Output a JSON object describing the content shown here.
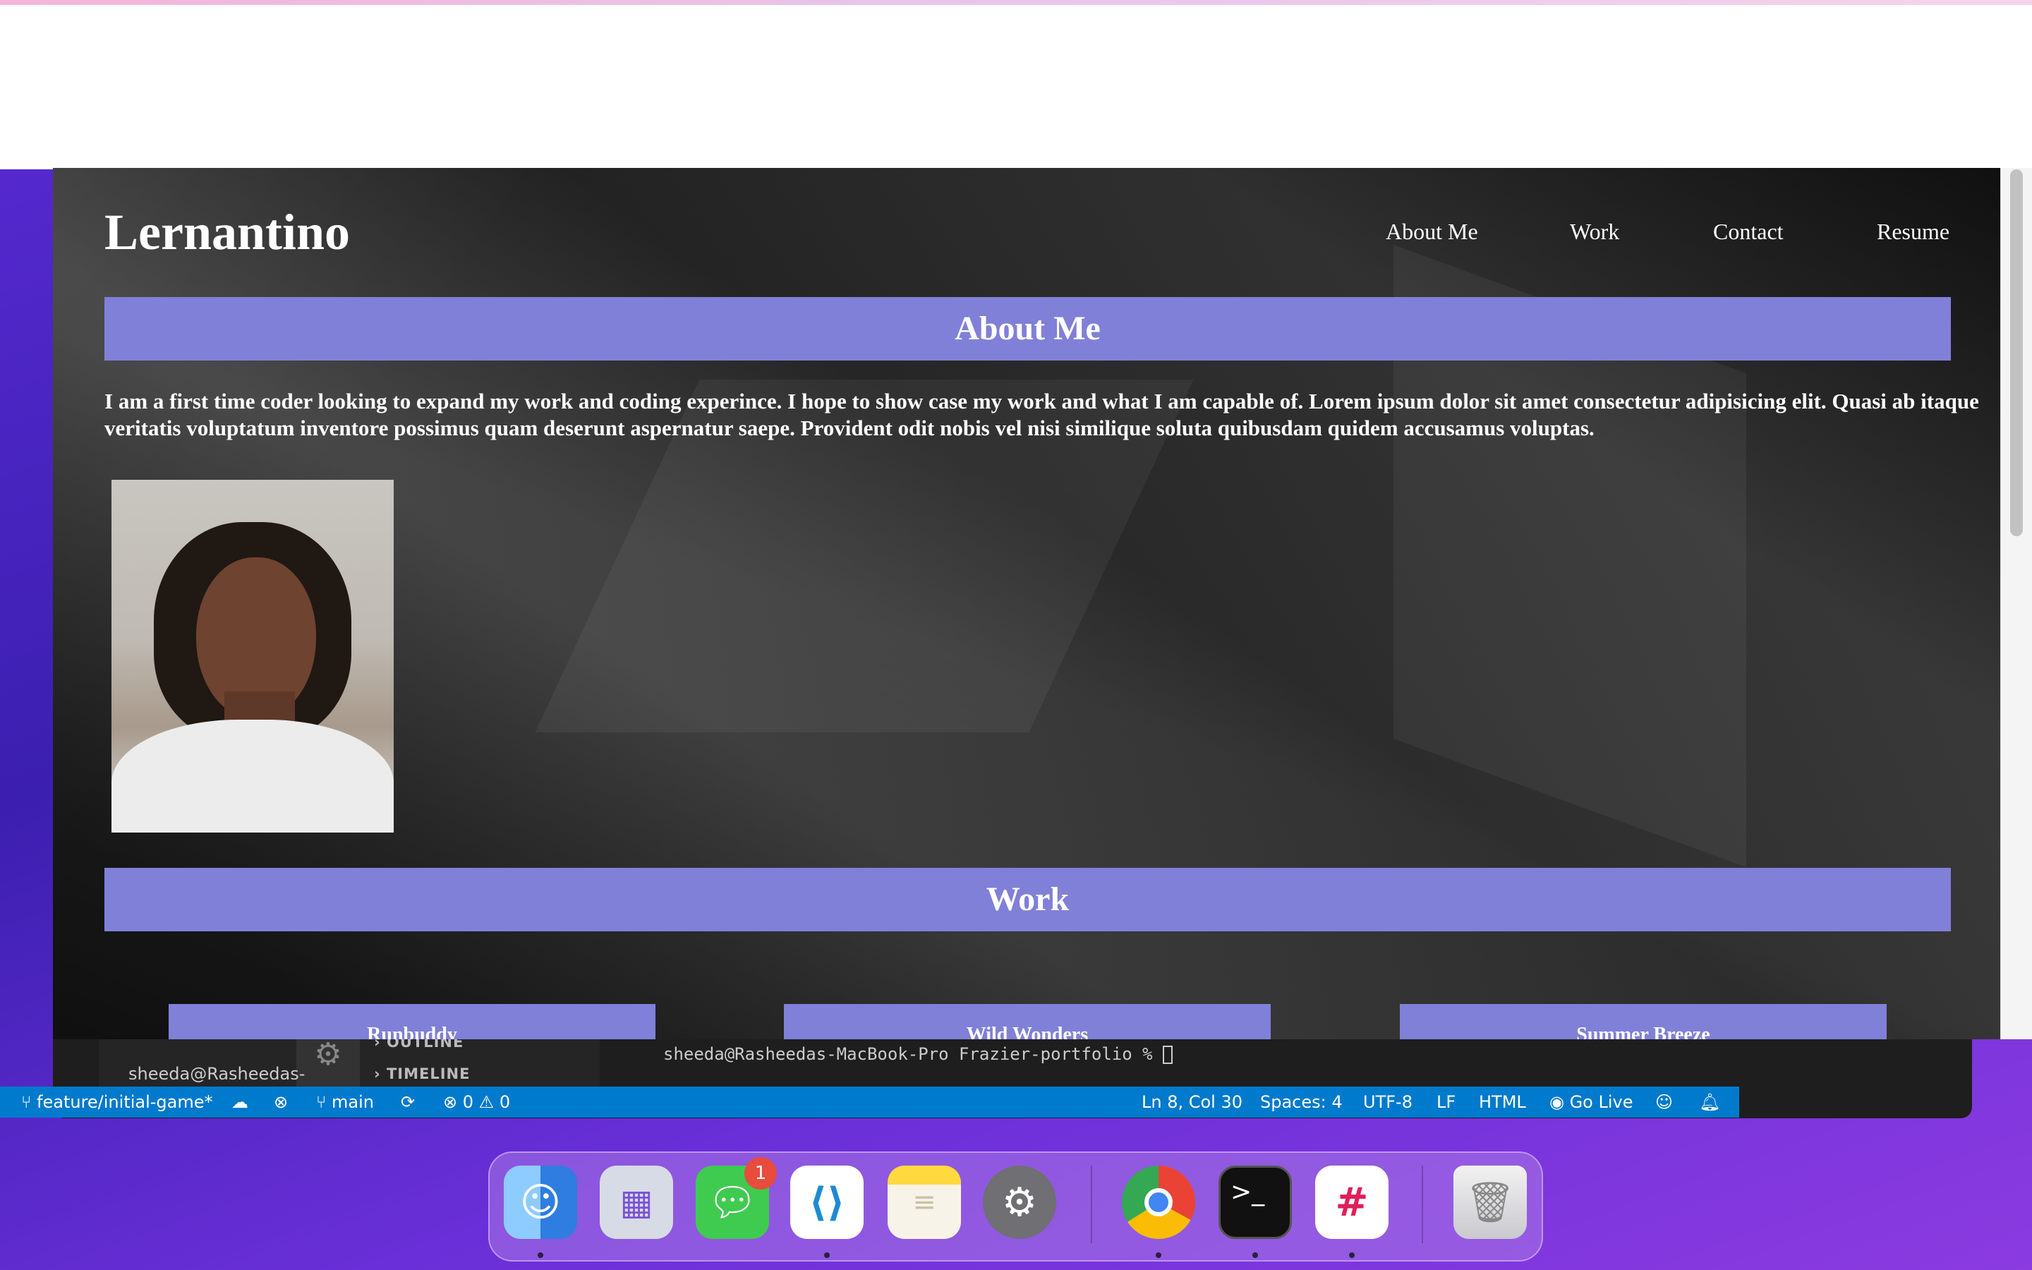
{
  "site": {
    "brand": "Lernantino",
    "nav": [
      "About Me",
      "Work",
      "Contact",
      "Resume"
    ],
    "about": {
      "heading": "About Me",
      "text": "I am a first time coder looking to expand my work and coding experince. I hope to show case my work and what I am capable of. Lorem ipsum dolor sit amet consectetur adipisicing elit. Quasi ab itaque veritatis voluptatum inventore possimus quam deserunt aspernatur saepe. Provident odit nobis vel nisi similique soluta quibusdam quidem accusamus voluptas."
    },
    "work": {
      "heading": "Work",
      "cards": [
        "Runbuddy",
        "Wild Wonders",
        "Summer Breeze"
      ]
    }
  },
  "vscode": {
    "user_prompt_partial": "sheeda@Rasheedas-",
    "sections": [
      "OUTLINE",
      "TIMELINE"
    ],
    "terminal_line": "sheeda@Rasheedas-MacBook-Pro Frazier-portfolio % ",
    "status": {
      "branch_left": "feature/initial-game*",
      "branch_main": "main",
      "errors": "0",
      "warnings": "0",
      "position": "Ln 8, Col 30",
      "spaces": "Spaces: 4",
      "encoding": "UTF-8",
      "eol": "LF",
      "language": "HTML",
      "go_live": "Go Live"
    }
  },
  "dock": {
    "apps": [
      "finder-icon",
      "launchpad-icon",
      "messages-icon",
      "vscode-icon",
      "notes-icon",
      "system-preferences-icon",
      "chrome-icon",
      "terminal-icon",
      "slack-icon",
      "trash-icon"
    ],
    "messages_badge": "1"
  },
  "colors": {
    "section_bar": "#8080d8",
    "status_bar": "#007acc"
  }
}
